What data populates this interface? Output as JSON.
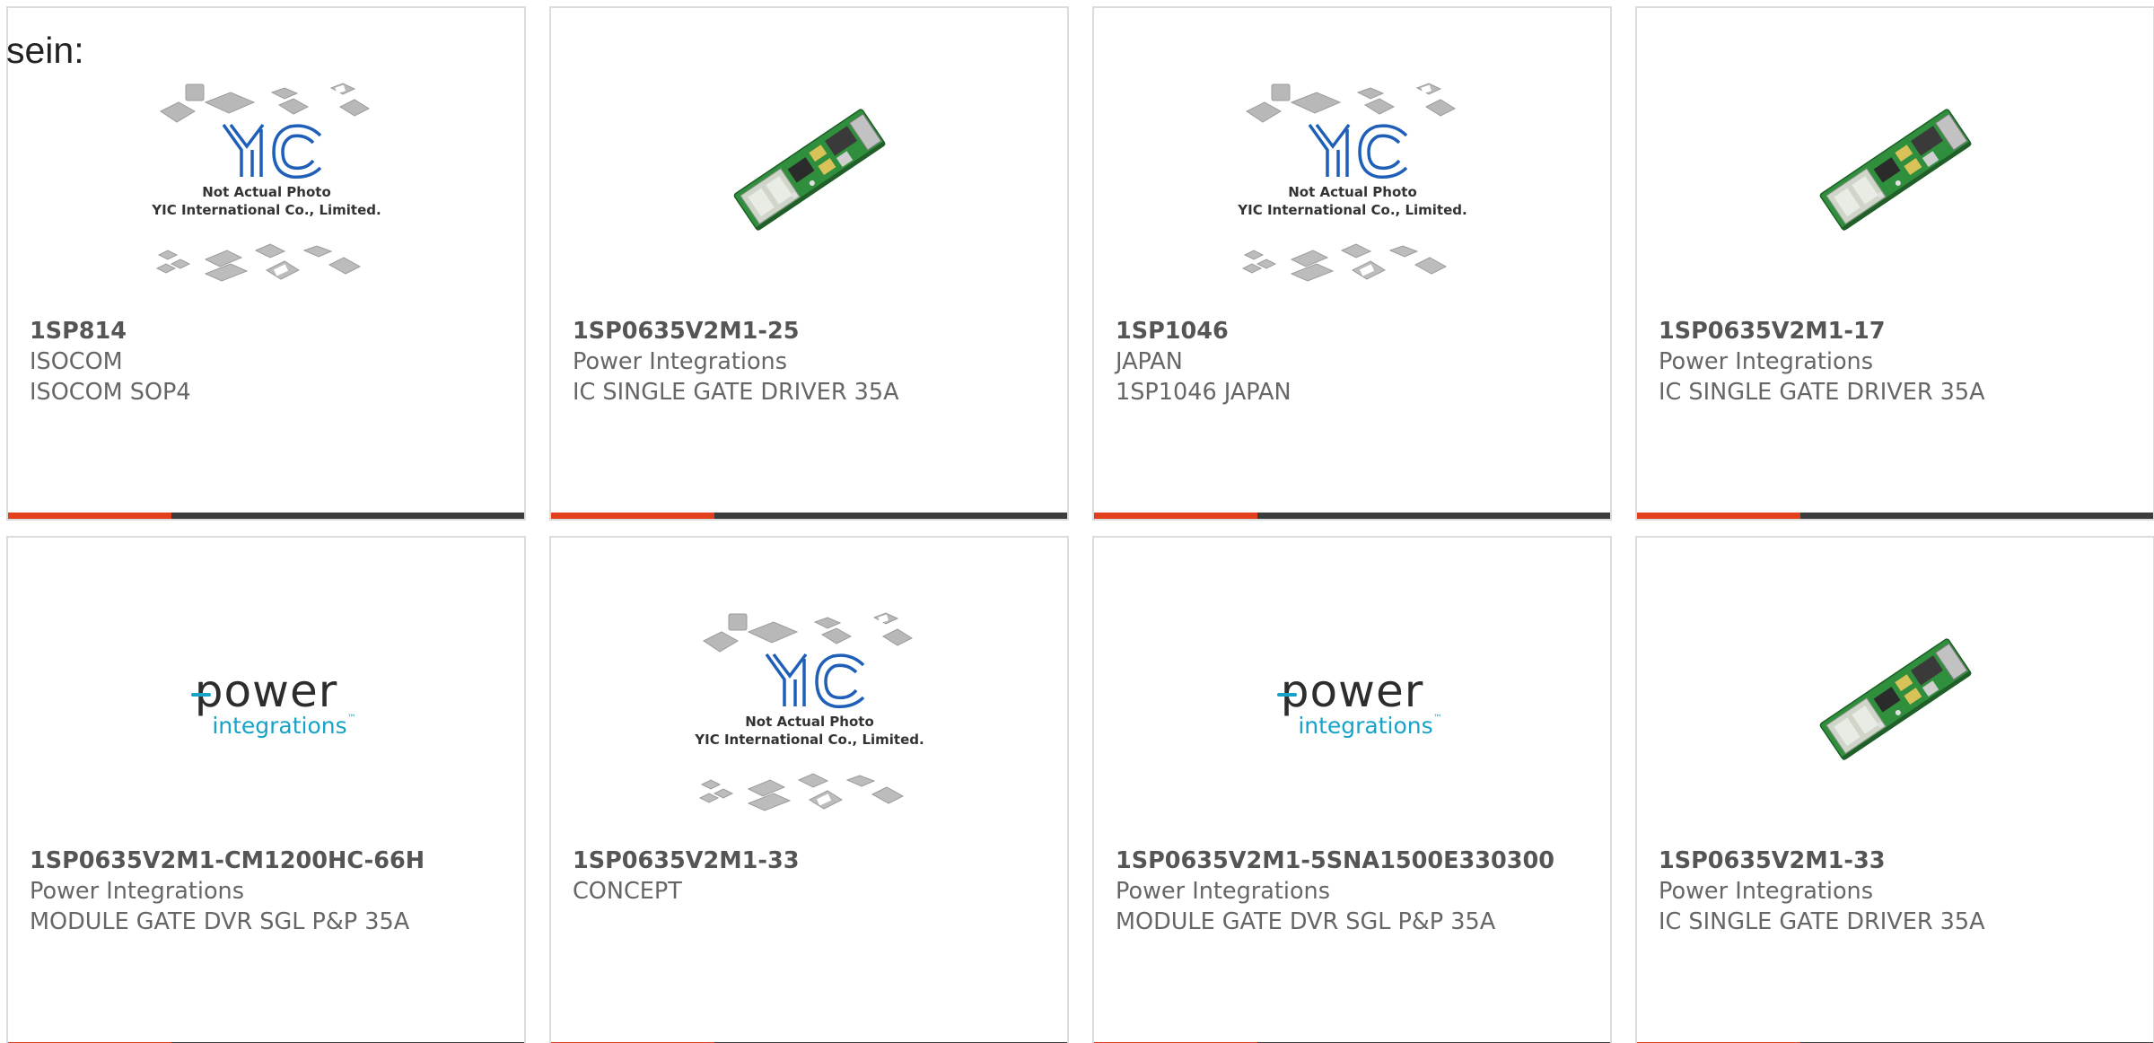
{
  "page": {
    "fragment_text": "sein:"
  },
  "colors": {
    "accent": "#e2401c",
    "bar_dark": "#3c3c3c",
    "text": "#666666",
    "border": "#dcdcdc"
  },
  "products": [
    {
      "part_number": "1SP814",
      "manufacturer": "ISOCOM",
      "description": "ISOCOM SOP4",
      "image": "yic-placeholder",
      "placeholder_line1": "Not Actual Photo",
      "placeholder_line2": "YIC International Co., Limited.",
      "placeholder_logo": "YIC"
    },
    {
      "part_number": "1SP0635V2M1-25",
      "manufacturer": "Power Integrations",
      "description": "IC SINGLE GATE DRIVER 35A",
      "image": "gate-driver-board"
    },
    {
      "part_number": "1SP1046",
      "manufacturer": "JAPAN",
      "description": "1SP1046 JAPAN",
      "image": "yic-placeholder",
      "placeholder_line1": "Not Actual Photo",
      "placeholder_line2": "YIC International Co., Limited.",
      "placeholder_logo": "YIC"
    },
    {
      "part_number": "1SP0635V2M1-17",
      "manufacturer": "Power Integrations",
      "description": "IC SINGLE GATE DRIVER 35A",
      "image": "gate-driver-board"
    },
    {
      "part_number": "1SP0635V2M1-CM1200HC-66H",
      "manufacturer": "Power Integrations",
      "description": "MODULE GATE DVR SGL P&P 35A",
      "image": "power-integrations-logo",
      "logo_word1": "power",
      "logo_word2": "integrations"
    },
    {
      "part_number": "1SP0635V2M1-33",
      "manufacturer": "CONCEPT",
      "description": "",
      "image": "yic-placeholder",
      "placeholder_line1": "Not Actual Photo",
      "placeholder_line2": "YIC International Co., Limited.",
      "placeholder_logo": "YIC"
    },
    {
      "part_number": "1SP0635V2M1-5SNA1500E330300",
      "manufacturer": "Power Integrations",
      "description": "MODULE GATE DVR SGL P&P 35A",
      "image": "power-integrations-logo",
      "logo_word1": "power",
      "logo_word2": "integrations"
    },
    {
      "part_number": "1SP0635V2M1-33",
      "manufacturer": "Power Integrations",
      "description": "IC SINGLE GATE DRIVER 35A",
      "image": "gate-driver-board"
    }
  ]
}
